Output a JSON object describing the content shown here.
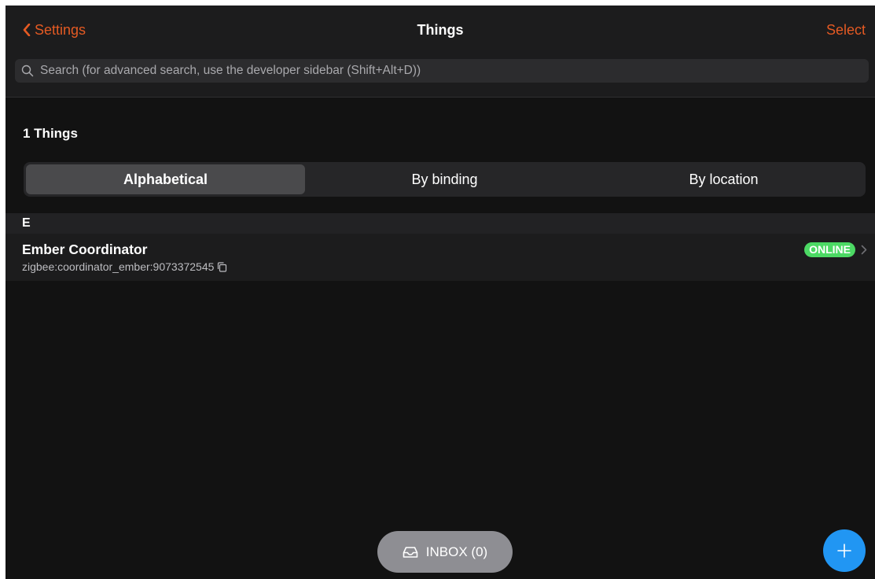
{
  "navbar": {
    "back_label": "Settings",
    "title": "Things",
    "select_label": "Select"
  },
  "search": {
    "placeholder": "Search (for advanced search, use the developer sidebar (Shift+Alt+D))",
    "value": ""
  },
  "list": {
    "count_title": "1 Things",
    "segments": [
      {
        "label": "Alphabetical",
        "active": true
      },
      {
        "label": "By binding",
        "active": false
      },
      {
        "label": "By location",
        "active": false
      }
    ],
    "groups": [
      {
        "header": "E",
        "items": [
          {
            "title": "Ember Coordinator",
            "uid": "zigbee:coordinator_ember:9073372545",
            "status": "ONLINE"
          }
        ]
      }
    ]
  },
  "inbox": {
    "label": "INBOX (0)"
  },
  "icons": {
    "back": "chevron-left-icon",
    "search": "search-icon",
    "copy": "copy-icon",
    "chevron": "chevron-right-icon",
    "inbox": "inbox-tray-icon",
    "fab": "plus-icon"
  },
  "colors": {
    "accent": "#e45a23",
    "online": "#4cd964",
    "fab": "#2196f3",
    "inbox_pill": "#8e8e93"
  }
}
